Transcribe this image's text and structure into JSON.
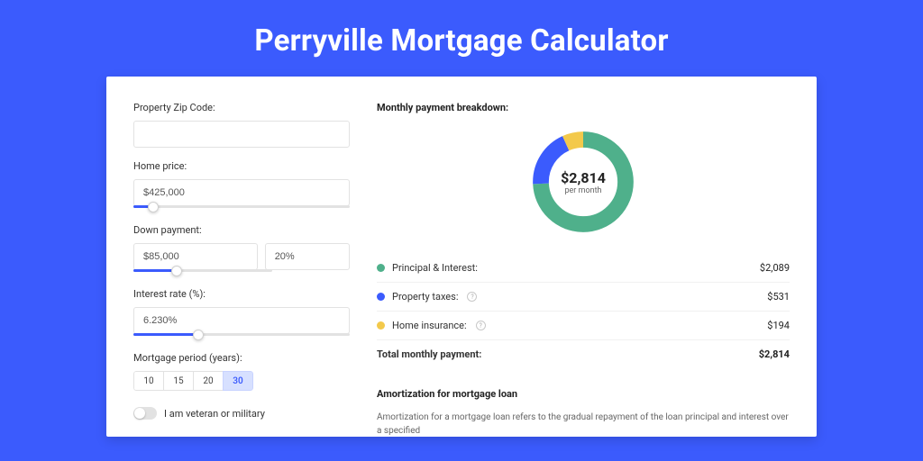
{
  "title": "Perryville Mortgage Calculator",
  "form": {
    "zipLabel": "Property Zip Code:",
    "zipValue": "",
    "homePriceLabel": "Home price:",
    "homePriceValue": "$425,000",
    "homePriceSliderPct": 9,
    "downPaymentLabel": "Down payment:",
    "downPaymentValue": "$85,000",
    "downPaymentPct": "20%",
    "downPaymentSliderPct": 20,
    "interestLabel": "Interest rate (%):",
    "interestValue": "6.230%",
    "interestSliderPct": 30,
    "periodLabel": "Mortgage period (years):",
    "periods": [
      "10",
      "15",
      "20",
      "30"
    ],
    "periodActive": "30",
    "veteranLabel": "I am veteran or military"
  },
  "breakdown": {
    "heading": "Monthly payment breakdown:",
    "centerValue": "$2,814",
    "centerSub": "per month",
    "items": [
      {
        "label": "Principal & Interest:",
        "value": "$2,089",
        "color": "#4fb08b",
        "info": false
      },
      {
        "label": "Property taxes:",
        "value": "$531",
        "color": "#3b5bfd",
        "info": true
      },
      {
        "label": "Home insurance:",
        "value": "$194",
        "color": "#f3c94b",
        "info": true
      }
    ],
    "totalLabel": "Total monthly payment:",
    "totalValue": "$2,814"
  },
  "amort": {
    "heading": "Amortization for mortgage loan",
    "text": "Amortization for a mortgage loan refers to the gradual repayment of the loan principal and interest over a specified"
  },
  "chart_data": {
    "type": "pie",
    "title": "Monthly payment breakdown",
    "series": [
      {
        "name": "Principal & Interest",
        "value": 2089,
        "color": "#4fb08b"
      },
      {
        "name": "Property taxes",
        "value": 531,
        "color": "#3b5bfd"
      },
      {
        "name": "Home insurance",
        "value": 194,
        "color": "#f3c94b"
      }
    ],
    "total": 2814,
    "center_label": "$2,814 per month"
  }
}
